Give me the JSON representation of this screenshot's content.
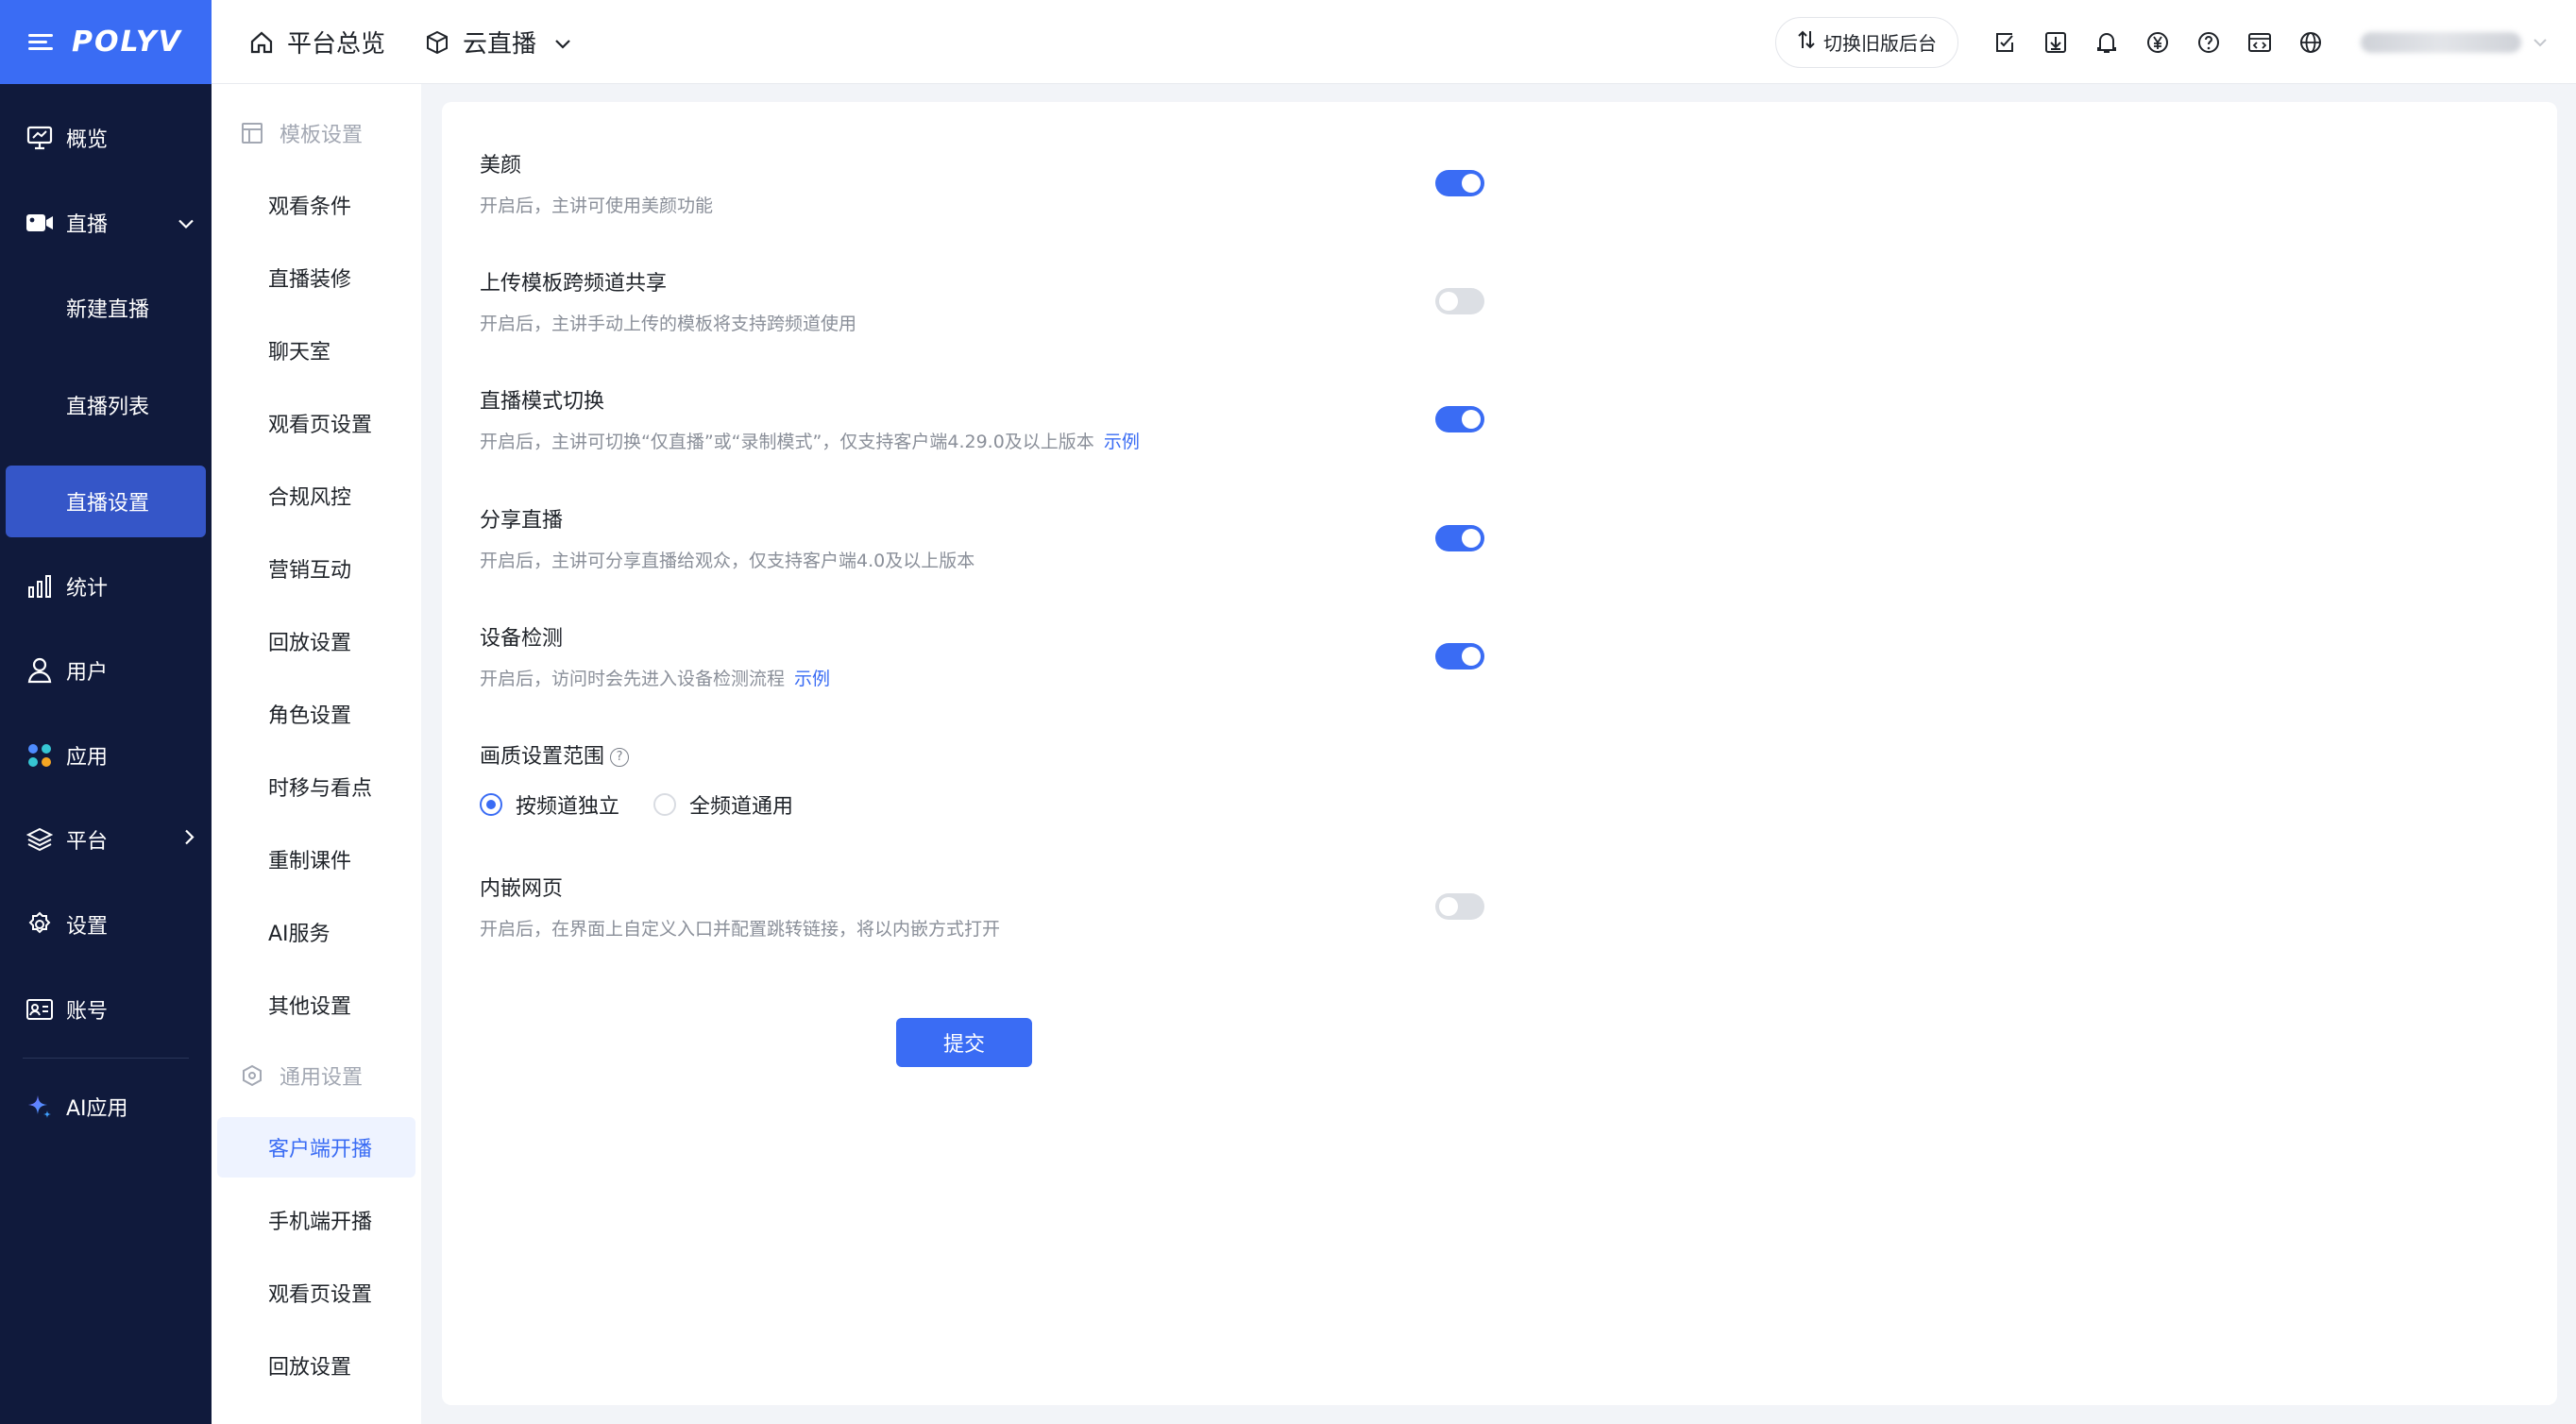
{
  "brand": {
    "logo": "POLYV"
  },
  "nav": {
    "items": [
      {
        "label": "概览",
        "icon": "monitor-icon"
      },
      {
        "label": "直播",
        "icon": "video-camera-icon"
      },
      {
        "label": "新建直播"
      },
      {
        "label": "直播列表"
      },
      {
        "label": "直播设置"
      },
      {
        "label": "统计",
        "icon": "bar-chart-icon"
      },
      {
        "label": "用户",
        "icon": "user-icon"
      },
      {
        "label": "应用",
        "icon": "apps-icon"
      },
      {
        "label": "平台",
        "icon": "layers-icon"
      },
      {
        "label": "设置",
        "icon": "gear-icon"
      },
      {
        "label": "账号",
        "icon": "id-card-icon"
      },
      {
        "label": "AI应用",
        "icon": "sparkle-icon"
      }
    ],
    "active": "直播设置"
  },
  "topbar": {
    "home_label": "平台总览",
    "product_label": "云直播",
    "switch_label": "切换旧版后台",
    "icons": [
      "checklist-icon",
      "download-icon",
      "bell-icon",
      "yen-icon",
      "help-icon",
      "code-window-icon",
      "globe-icon"
    ]
  },
  "submenu": {
    "group1": "模板设置",
    "group1_items": [
      "观看条件",
      "直播装修",
      "聊天室",
      "观看页设置",
      "合规风控",
      "营销互动",
      "回放设置",
      "角色设置",
      "时移与看点",
      "重制课件",
      "AI服务",
      "其他设置"
    ],
    "group2": "通用设置",
    "group2_items": [
      "客户端开播",
      "手机端开播",
      "观看页设置",
      "回放设置"
    ],
    "active": "客户端开播"
  },
  "settings": {
    "rows": [
      {
        "title": "美颜",
        "desc": "开启后，主讲可使用美颜功能",
        "enabled": true
      },
      {
        "title": "上传模板跨频道共享",
        "desc": "开启后，主讲手动上传的模板将支持跨频道使用",
        "enabled": false
      },
      {
        "title": "直播模式切换",
        "desc": "开启后，主讲可切换“仅直播”或“录制模式”，仅支持客户端4.29.0及以上版本",
        "link": "示例",
        "enabled": true
      },
      {
        "title": "分享直播",
        "desc": "开启后，主讲可分享直播给观众，仅支持客户端4.0及以上版本",
        "enabled": true
      },
      {
        "title": "设备检测",
        "desc": "开启后，访问时会先进入设备检测流程",
        "link": "示例",
        "enabled": true
      }
    ],
    "quality": {
      "title": "画质设置范围",
      "options": [
        "按频道独立",
        "全频道通用"
      ],
      "selected": "按频道独立"
    },
    "embed": {
      "title": "内嵌网页",
      "desc": "开启后，在界面上自定义入口并配置跳转链接，将以内嵌方式打开",
      "enabled": false
    },
    "submit_label": "提交"
  },
  "colors": {
    "primary": "#3a6cf4",
    "nav_bg": "#101a3c",
    "nav_active": "#3556c8"
  }
}
